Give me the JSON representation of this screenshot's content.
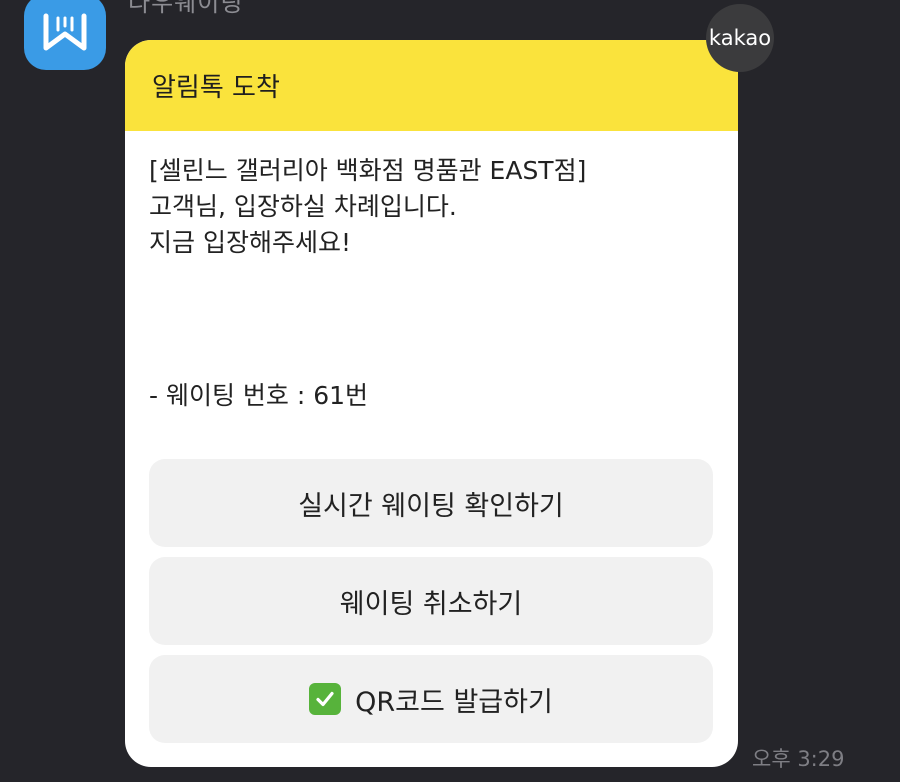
{
  "sender": {
    "name": "다우웨이팅",
    "avatar_icon": "w-logo-icon",
    "avatar_color": "#3a9be6"
  },
  "badge": {
    "label": "kakao"
  },
  "message": {
    "header_title": "알림톡 도착",
    "header_color": "#fae33c",
    "lines": [
      "[셀린느 갤러리아 백화점 명품관 EAST점]",
      "고객님, 입장하실 차례입니다.",
      "지금 입장해주세요!"
    ],
    "number_text": "- 웨이팅 번호 : 61번",
    "buttons": [
      {
        "label": "실시간 웨이팅 확인하기"
      },
      {
        "label": "웨이팅 취소하기"
      },
      {
        "label": "QR코드 발급하기",
        "icon": "check-mark-button-icon"
      }
    ]
  },
  "timestamp": "오후 3:29"
}
